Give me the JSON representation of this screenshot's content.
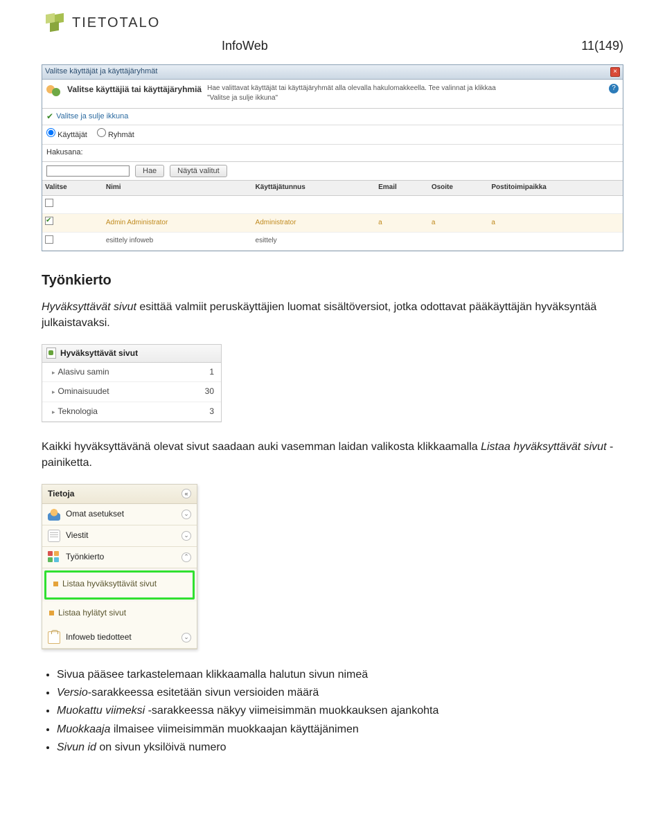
{
  "brand": {
    "name": "TIETOTALO"
  },
  "doc": {
    "title": "InfoWeb",
    "page": "11(149)"
  },
  "dialog": {
    "titlebar": "Valitse käyttäjät ja käyttäjäryhmät",
    "heading": "Valitse käyttäjiä tai käyttäjäryhmiä",
    "sub": "Hae valittavat käyttäjät tai käyttäjäryhmät alla olevalla hakulomakkeella. Tee valinnat ja klikkaa \"Valitse ja sulje ikkuna\"",
    "close_action": "Valitse ja sulje ikkuna",
    "radio_users": "Käyttäjät",
    "radio_groups": "Ryhmät",
    "search_label": "Hakusana:",
    "btn_search": "Hae",
    "btn_show": "Näytä valitut",
    "cols": {
      "select": "Valitse",
      "name": "Nimi",
      "user": "Käyttäjätunnus",
      "email": "Email",
      "addr": "Osoite",
      "city": "Postitoimipaikka"
    },
    "rows": [
      {
        "selected": true,
        "name": "Admin Administrator",
        "user": "Administrator",
        "email": "a",
        "addr": "a",
        "city": "a"
      },
      {
        "selected": false,
        "name": "esittely infoweb",
        "user": "esittely",
        "email": "",
        "addr": "",
        "city": ""
      }
    ]
  },
  "section_title": "Työnkierto",
  "para1_a": "Hyväksyttävät sivut",
  "para1_b": " esittää valmiit peruskäyttäjien luomat sisältöversiot, jotka odottavat pääkäyttäjän hyväksyntää julkaistavaksi.",
  "approve_widget": {
    "title": "Hyväksyttävät sivut",
    "rows": [
      {
        "name": "Alasivu samin",
        "count": "1"
      },
      {
        "name": "Ominaisuudet",
        "count": "30"
      },
      {
        "name": "Teknologia",
        "count": "3"
      }
    ]
  },
  "para2_a": "Kaikki hyväksyttävänä olevat sivut saadaan auki vasemman laidan valikosta klikkaamalla ",
  "para2_b": "Listaa hyväksyttävät sivut",
  "para2_c": " -painiketta.",
  "panel": {
    "title": "Tietoja",
    "items": {
      "settings": "Omat asetukset",
      "messages": "Viestit",
      "workflow": "Työnkierto",
      "list_approve": "Listaa hyväksyttävät sivut",
      "list_reject": "Listaa hylätyt sivut",
      "news": "Infoweb tiedotteet"
    }
  },
  "bullets": {
    "b1": "Sivua pääsee tarkastelemaan klikkaamalla halutun sivun nimeä",
    "b2a": "Versio",
    "b2b": "-sarakkeessa esitetään sivun versioiden määrä",
    "b3a": "Muokattu viimeksi",
    "b3b": " -sarakkeessa näkyy viimeisimmän muokkauksen ajankohta",
    "b4a": "Muokkaaja",
    "b4b": " ilmaisee viimeisimmän muokkaajan käyttäjänimen",
    "b5a": "Sivun id",
    "b5b": " on sivun yksilöivä numero"
  }
}
